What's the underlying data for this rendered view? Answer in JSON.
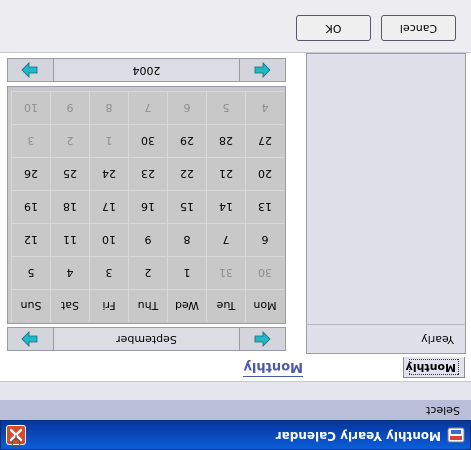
{
  "window": {
    "title": "Monthly Yearly Calendar",
    "app_icon": "calendar-app-icon",
    "close_icon": "close-icon"
  },
  "menu": {
    "select_label": "Select"
  },
  "tabs": {
    "active_label": "Monthly",
    "caption": "Monthly"
  },
  "sidebar": {
    "items": [
      {
        "label": "Yearly"
      }
    ]
  },
  "calendar": {
    "month_label": "September",
    "year_label": "2004",
    "nav_icons": {
      "prev": "left-arrow-icon",
      "next": "right-arrow-icon"
    },
    "weekday_headers": [
      "Mon",
      "Tue",
      "Wed",
      "Thu",
      "Fri",
      "Sat",
      "Sun"
    ],
    "weeks": [
      [
        {
          "d": "30",
          "other": true
        },
        {
          "d": "31",
          "other": true
        },
        {
          "d": "1"
        },
        {
          "d": "2"
        },
        {
          "d": "3"
        },
        {
          "d": "4"
        },
        {
          "d": "5"
        }
      ],
      [
        {
          "d": "6"
        },
        {
          "d": "7"
        },
        {
          "d": "8"
        },
        {
          "d": "9"
        },
        {
          "d": "10"
        },
        {
          "d": "11"
        },
        {
          "d": "12"
        }
      ],
      [
        {
          "d": "13"
        },
        {
          "d": "14"
        },
        {
          "d": "15"
        },
        {
          "d": "16"
        },
        {
          "d": "17"
        },
        {
          "d": "18"
        },
        {
          "d": "19"
        }
      ],
      [
        {
          "d": "20"
        },
        {
          "d": "21"
        },
        {
          "d": "22"
        },
        {
          "d": "23"
        },
        {
          "d": "24"
        },
        {
          "d": "25"
        },
        {
          "d": "26"
        }
      ],
      [
        {
          "d": "27"
        },
        {
          "d": "28"
        },
        {
          "d": "29"
        },
        {
          "d": "30"
        },
        {
          "d": "1",
          "other": true
        },
        {
          "d": "2",
          "other": true
        },
        {
          "d": "3",
          "other": true
        }
      ],
      [
        {
          "d": "4",
          "other": true
        },
        {
          "d": "5",
          "other": true
        },
        {
          "d": "6",
          "other": true
        },
        {
          "d": "7",
          "other": true
        },
        {
          "d": "8",
          "other": true
        },
        {
          "d": "9",
          "other": true
        },
        {
          "d": "10",
          "other": true
        }
      ]
    ]
  },
  "buttons": {
    "ok_label": "OK",
    "cancel_label": "Cancel"
  },
  "colors": {
    "titlebar": "#0a5fd8",
    "arrow": "#1fb8c4",
    "grid_bg": "#c8c8c8",
    "close": "#d84a2a"
  }
}
